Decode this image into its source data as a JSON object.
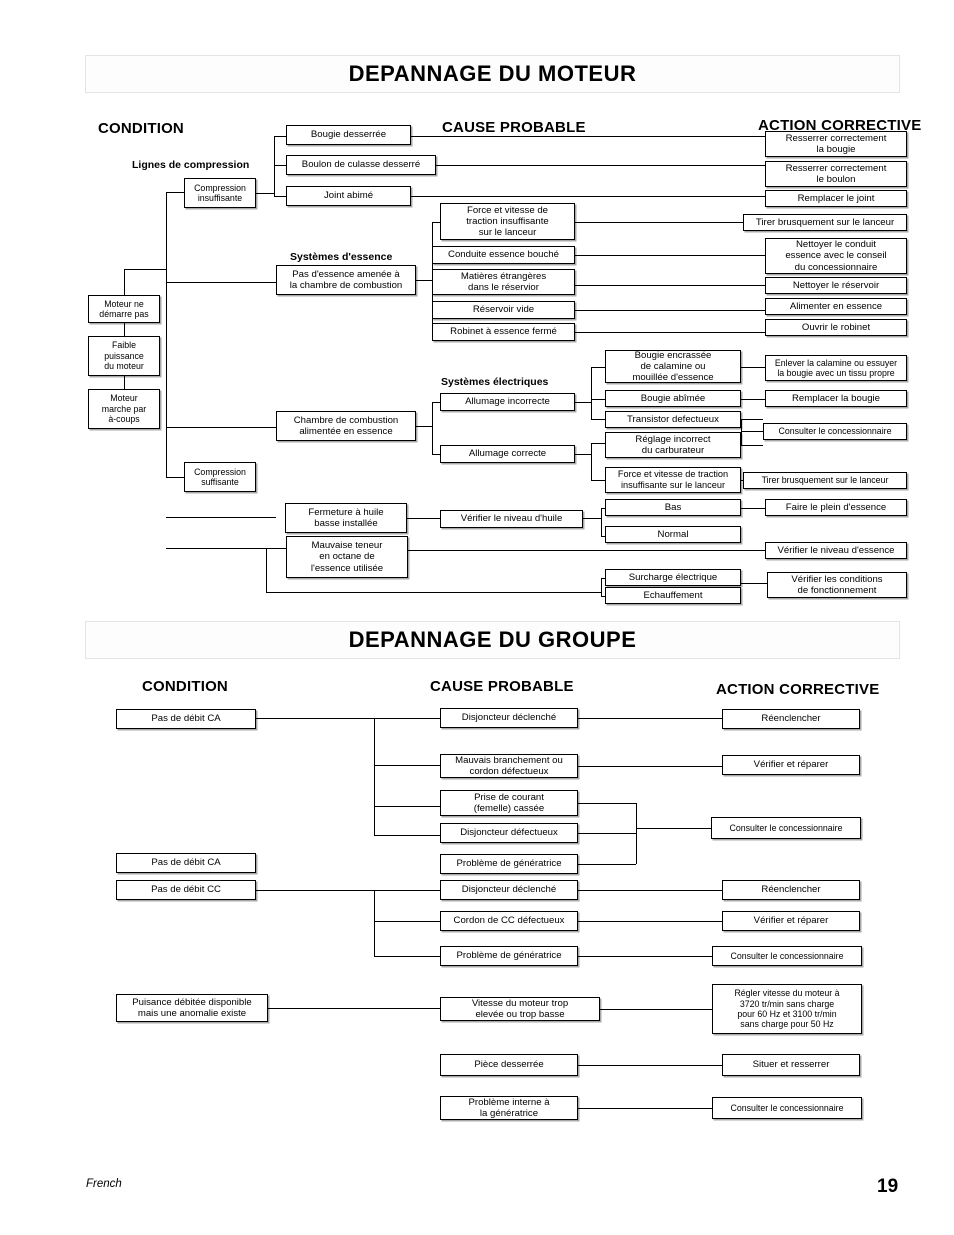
{
  "page": {
    "footer_language": "French",
    "footer_page_number": "19"
  },
  "section_engine": {
    "banner_title": "DEPANNAGE DU MOTEUR",
    "headers": {
      "condition": "CONDITION",
      "cause": "CAUSE PROBABLE",
      "action": "ACTION CORRECTIVE"
    },
    "group_labels": {
      "compression": "Lignes de compression",
      "fuel": "Systèmes d'essence",
      "electrical": "Systèmes électriques"
    },
    "conditions": [
      {
        "label": "Moteur ne\ndémarre pas"
      },
      {
        "label": "Faible\npuissance\ndu moteur"
      },
      {
        "label": "Moteur\nmarche par\nà-coups"
      }
    ],
    "branches": [
      {
        "label": "Compression\ninsuffisante"
      },
      {
        "label": "Compression\nsuffisante"
      }
    ],
    "sub_conditions": [
      {
        "label": "Pas d'essence amenée à\nla chambre de combustion"
      },
      {
        "label": "Chambre de combustion\nalimentée en essence"
      },
      {
        "label": "Fermeture à huile\nbasse installée"
      },
      {
        "label": "Mauvaise teneur\nen octane de\nl'essence utilisée"
      }
    ],
    "ignition_states": [
      {
        "label": "Allumage incorrecte"
      },
      {
        "label": "Allumage correcte"
      }
    ],
    "oil_check": {
      "label": "Vérifier le niveau d'huile"
    },
    "oil_levels": [
      {
        "label": "Bas"
      },
      {
        "label": "Normal"
      }
    ],
    "causes": [
      {
        "label": "Bougie desserrée"
      },
      {
        "label": "Boulon de culasse desserré"
      },
      {
        "label": "Joint abimé"
      },
      {
        "label": "Force et vitesse de\ntraction insuffisante\nsur le lanceur"
      },
      {
        "label": "Conduite essence bouché"
      },
      {
        "label": "Matières étrangères\ndans le réservior"
      },
      {
        "label": "Réservoir vide"
      },
      {
        "label": "Robinet à essence fermé"
      },
      {
        "label": "Bougie encrassée\nde calamine ou\nmouillée d'essence"
      },
      {
        "label": "Bougie abîmée"
      },
      {
        "label": "Transistor defectueux"
      },
      {
        "label": "Réglage incorrect\ndu carburateur"
      },
      {
        "label": "Force et vitesse de traction\ninsuffisante sur le lanceur"
      },
      {
        "label": "Surcharge électrique"
      },
      {
        "label": "Echauffement"
      }
    ],
    "actions": [
      {
        "label": "Resserrer correctement\nla bougie"
      },
      {
        "label": "Resserrer correctement\nle boulon"
      },
      {
        "label": "Remplacer le joint"
      },
      {
        "label": "Tirer brusquement sur le lanceur"
      },
      {
        "label": "Nettoyer le conduit\nessence avec le conseil\ndu concessionnaire"
      },
      {
        "label": "Nettoyer le réservoir"
      },
      {
        "label": "Alimenter en essence"
      },
      {
        "label": "Ouvrir le robinet"
      },
      {
        "label": "Enlever la calamine ou essuyer\nla bougie avec un tissu propre"
      },
      {
        "label": "Remplacer la bougie"
      },
      {
        "label": "Consulter le concessionnaire"
      },
      {
        "label": "Tirer brusquement sur le lanceur"
      },
      {
        "label": "Faire le plein d'essence"
      },
      {
        "label": "Vérifier le niveau d'essence"
      },
      {
        "label": "Vérifier les conditions\nde fonctionnement"
      }
    ]
  },
  "section_generator": {
    "banner_title": "DEPANNAGE DU GROUPE",
    "headers": {
      "condition": "CONDITION",
      "cause": "CAUSE PROBABLE",
      "action": "ACTION CORRECTIVE"
    },
    "conditions": [
      {
        "label": "Pas de débit CA"
      },
      {
        "label": "Pas de débit CA"
      },
      {
        "label": "Pas de débit CC"
      },
      {
        "label": "Puisance débitée disponible\nmais une anomalie existe"
      }
    ],
    "causes": [
      {
        "label": "Disjoncteur déclenché"
      },
      {
        "label": "Mauvais branchement ou\ncordon défectueux"
      },
      {
        "label": "Prise de courant\n(femelle) cassée"
      },
      {
        "label": "Disjoncteur défectueux"
      },
      {
        "label": "Problème de génératrice"
      },
      {
        "label": "Disjoncteur déclenché"
      },
      {
        "label": "Cordon de CC défectueux"
      },
      {
        "label": "Problème de génératrice"
      },
      {
        "label": "Vitesse du moteur trop\nelevée ou trop basse"
      },
      {
        "label": "Pièce desserrée"
      },
      {
        "label": "Problème interne à\nla génératrice"
      }
    ],
    "actions": [
      {
        "label": "Réenclencher"
      },
      {
        "label": "Vérifier et réparer"
      },
      {
        "label": "Consulter le concessionnaire"
      },
      {
        "label": "Réenclencher"
      },
      {
        "label": "Vérifier et réparer"
      },
      {
        "label": "Consulter le concessionnaire"
      },
      {
        "label": "Régler vitesse du moteur à\n3720 tr/min sans charge\npour 60 Hz et 3100 tr/min\nsans charge pour 50 Hz"
      },
      {
        "label": "Situer et resserrer"
      },
      {
        "label": "Consulter le concessionnaire"
      }
    ]
  }
}
